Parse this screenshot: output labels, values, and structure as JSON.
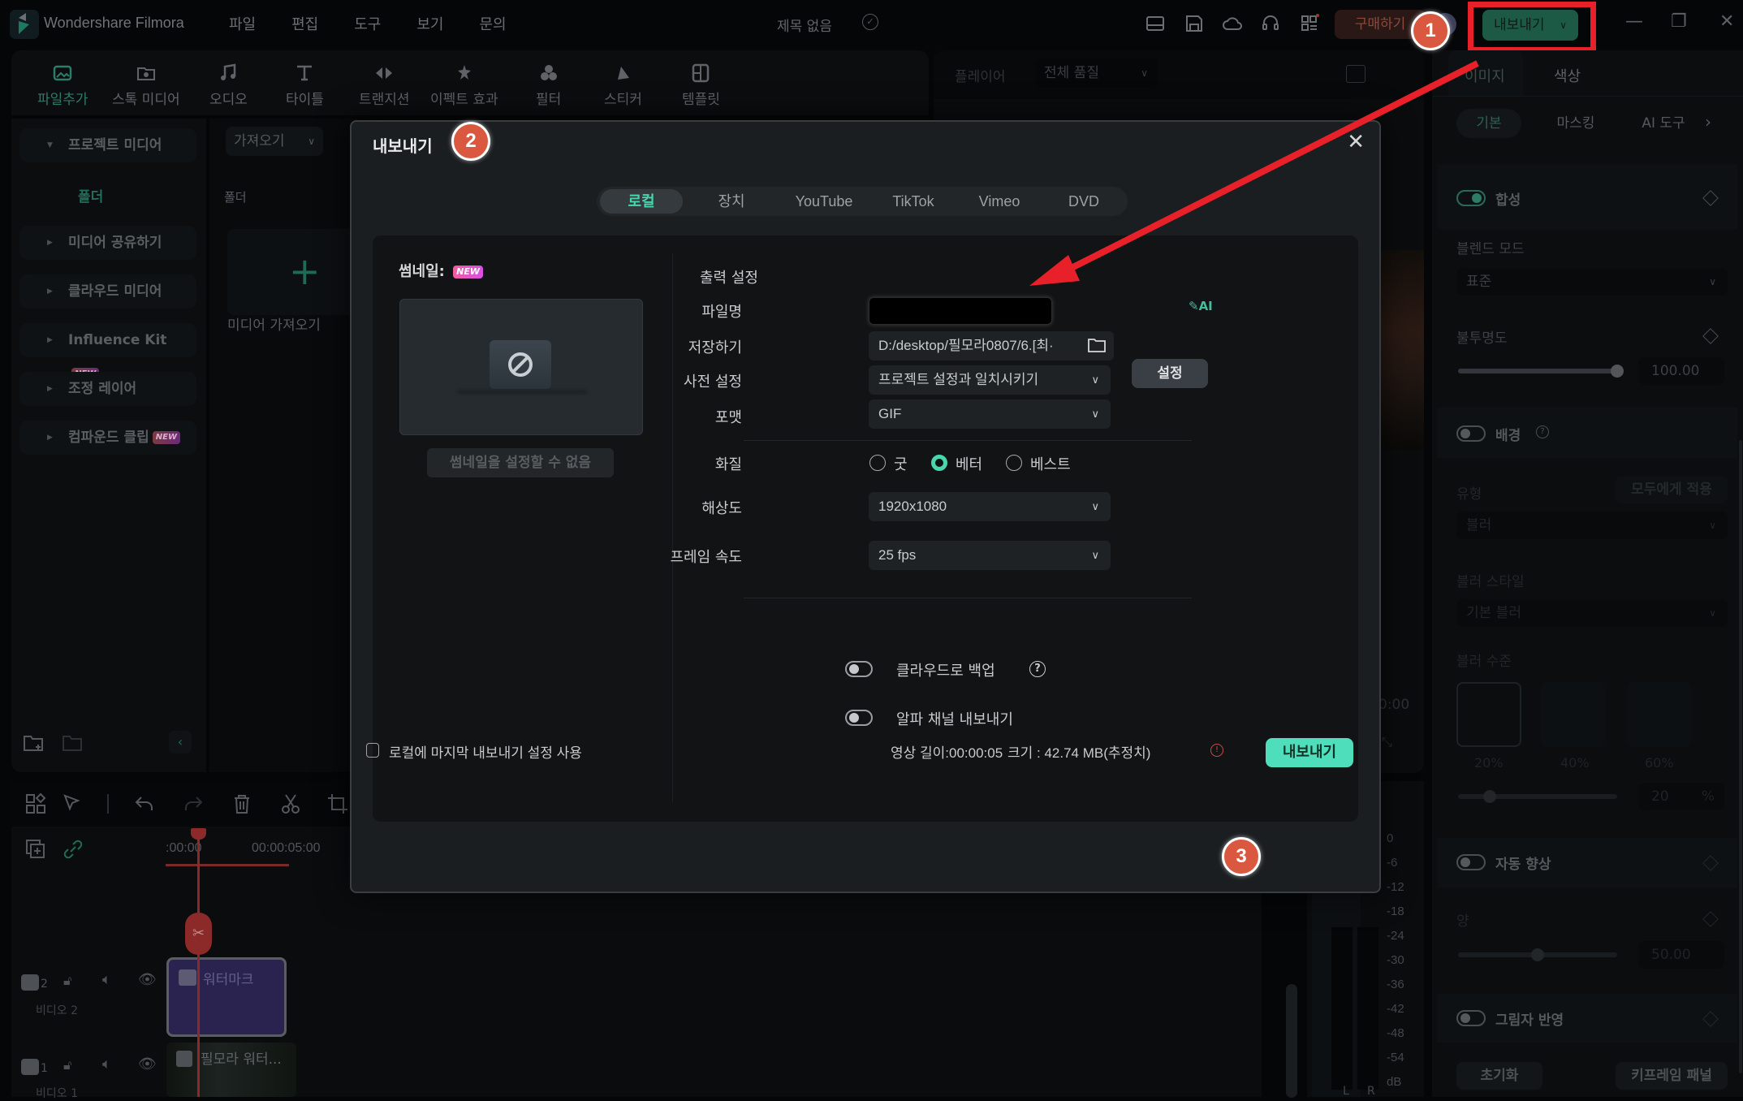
{
  "app": {
    "name": "Wondershare Filmora",
    "menu": [
      "파일",
      "편집",
      "도구",
      "보기",
      "문의"
    ],
    "doc_title": "제목 없음",
    "buy_label": "구매하기",
    "export_label": "내보내기"
  },
  "toolbar": {
    "items": [
      {
        "label": "파일추가",
        "icon": "import-media-icon",
        "active": true
      },
      {
        "label": "스톡 미디어",
        "icon": "stock-media-icon"
      },
      {
        "label": "오디오",
        "icon": "music-note-icon"
      },
      {
        "label": "타이틀",
        "icon": "title-t-icon"
      },
      {
        "label": "트랜지션",
        "icon": "transition-icon"
      },
      {
        "label": "이펙트 효과",
        "icon": "effects-wand-icon"
      },
      {
        "label": "필터",
        "icon": "filter-circles-icon"
      },
      {
        "label": "스티커",
        "icon": "sticker-icon"
      },
      {
        "label": "템플릿",
        "icon": "template-icon"
      }
    ]
  },
  "sidebar": {
    "items": [
      {
        "label": "프로젝트 미디어",
        "expanded": true
      },
      {
        "label": "미디어 공유하기"
      },
      {
        "label": "클라우드 미디어"
      },
      {
        "label": "Influence Kit",
        "tag": "NEW"
      },
      {
        "label": "조정 레이어"
      },
      {
        "label": "컴파운드 클립",
        "tag": "NEW"
      }
    ],
    "folder": "폴더"
  },
  "media": {
    "import_label": "가져오기",
    "folder_label": "폴더",
    "import_tile_label": "미디어 가져오기"
  },
  "player": {
    "label": "플레이어",
    "quality": "전체 품질",
    "time": "0:00"
  },
  "right_panel": {
    "tabs": [
      "이미지",
      "색상"
    ],
    "subtabs": [
      "기본",
      "마스킹",
      "AI 도구"
    ],
    "compose": {
      "label": "합성",
      "on": true
    },
    "blend_mode": {
      "label": "블렌드 모드",
      "value": "표준"
    },
    "opacity": {
      "label": "불투명도",
      "value": "100.00",
      "fraction": 1.0
    },
    "background": {
      "label": "배경",
      "on": false
    },
    "type": {
      "label": "유형",
      "apply_all": "모두에게 적용",
      "value": "블러"
    },
    "blur_style": {
      "label": "블러 스타일",
      "value": "기본 블러"
    },
    "blur_level": {
      "label": "블러 수준",
      "presets": [
        "20%",
        "40%",
        "60%"
      ],
      "value": "20",
      "unit": "%",
      "fraction": 0.2
    },
    "auto_enhance": {
      "label": "자동 향상",
      "on": false
    },
    "amount": {
      "label": "양",
      "value": "50.00",
      "fraction": 0.5
    },
    "shadow": {
      "label": "그림자 반영",
      "on": false
    },
    "reset_label": "초기화",
    "keyframe_label": "키프레임 패널"
  },
  "timeline": {
    "ruler": [
      ":00:00",
      "00:00:05:00"
    ],
    "tracks": [
      {
        "num": "2",
        "name": "비디오 2",
        "clip": "워터마크"
      },
      {
        "num": "1",
        "name": "비디오 1",
        "clip": "필모라 워터..."
      }
    ],
    "db_scale": [
      "0",
      "-6",
      "-12",
      "-18",
      "-24",
      "-30",
      "-36",
      "-42",
      "-48",
      "-54",
      "dB"
    ],
    "channels": [
      "L",
      "R"
    ]
  },
  "dialog": {
    "title": "내보내기",
    "tabs": [
      "로컬",
      "장치",
      "YouTube",
      "TikTok",
      "Vimeo",
      "DVD"
    ],
    "active_tab": "로컬",
    "thumbnail_label": "썸네일:",
    "new_tag": "NEW",
    "thumbnail_button": "썸네일을 설정할 수 없음",
    "output_title": "출력 설정",
    "fields": {
      "filename": {
        "label": "파일명",
        "value": ""
      },
      "save_to": {
        "label": "저장하기",
        "value": "D:/desktop/필모라0807/6.[최·"
      },
      "preset": {
        "label": "사전 설정",
        "value": "프로젝트 설정과 일치시키기",
        "button": "설정"
      },
      "format": {
        "label": "포맷",
        "value": "GIF"
      },
      "quality": {
        "label": "화질",
        "options": [
          "굿",
          "베터",
          "베스트"
        ],
        "selected": "베터"
      },
      "resolution": {
        "label": "해상도",
        "value": "1920x1080"
      },
      "frame_rate": {
        "label": "프레임 속도",
        "value": "25 fps"
      }
    },
    "cloud_backup": {
      "label": "클라우드로 백업",
      "on": false
    },
    "alpha_channel": {
      "label": "알파 채널 내보내기",
      "on": false
    },
    "footer": {
      "remember_label": "로컬에 마지막 내보내기 설정 사용",
      "duration": "영상 길이:00:00:05",
      "size": "크기 : 42.74 MB(추정치)",
      "export_button": "내보내기"
    }
  },
  "annotations": {
    "badges": [
      "1",
      "2",
      "3"
    ],
    "highlight_color": "#e8202a",
    "badge_color": "#d9583f"
  },
  "colors": {
    "accent": "#48d6ae",
    "export_button": "#4fdebb"
  }
}
